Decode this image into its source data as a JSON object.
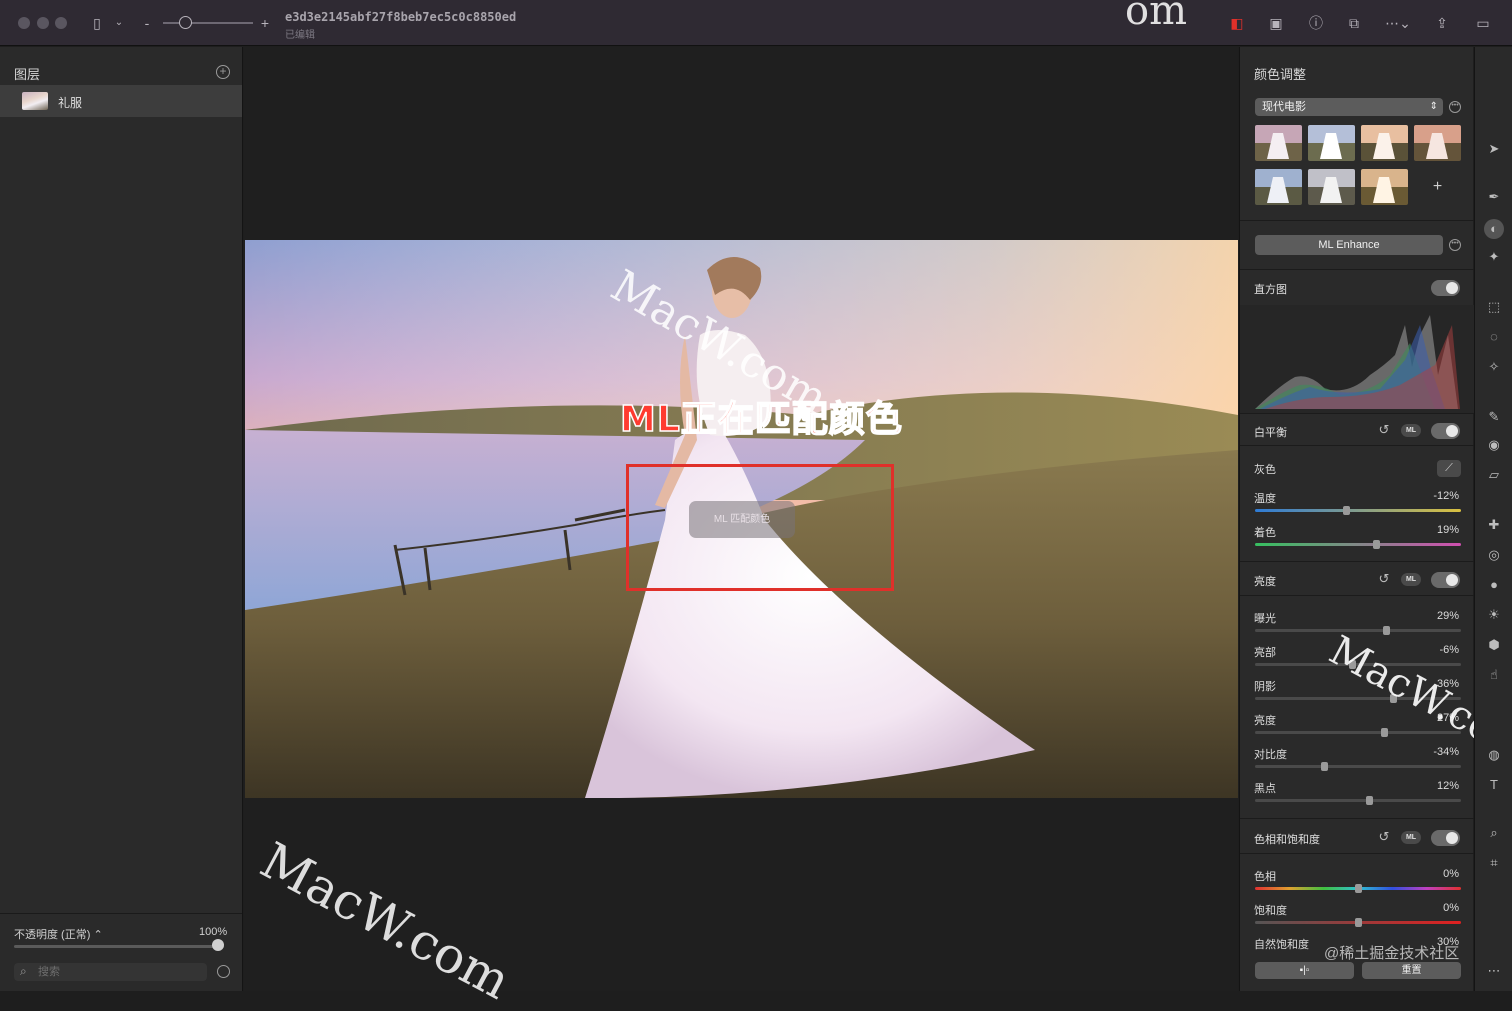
{
  "window": {
    "doc_title": "e3d3e2145abf27f8beb7ec5c0c8850ed",
    "doc_status": "已编辑",
    "minus": "-",
    "plus": "+"
  },
  "layers_panel": {
    "title": "图层",
    "layers": [
      {
        "name": "礼服"
      }
    ],
    "opacity_label": "不透明度 (正常) ⌃",
    "opacity_value": "100%",
    "opacity_fraction": 1.0,
    "search_placeholder": "搜索"
  },
  "canvas": {
    "overlay_text": "ML正在匹配颜色",
    "toast_text": "ML 匹配颜色",
    "watermarks": [
      "MacW.com",
      "MacW.com",
      "MacW.com",
      "MacW.co",
      "om"
    ]
  },
  "color_panel": {
    "title": "颜色调整",
    "preset": "现代电影",
    "preset_thumbnails": 7,
    "ml_enhance": "ML Enhance",
    "histogram": {
      "label": "直方图",
      "enabled": true
    },
    "white_balance": {
      "label": "白平衡",
      "ml": "ML",
      "gray_label": "灰色",
      "rows": [
        {
          "label": "温度",
          "value": "-12%",
          "fraction": -0.12
        },
        {
          "label": "着色",
          "value": "19%",
          "fraction": 0.19
        }
      ]
    },
    "lightness": {
      "label": "亮度",
      "ml": "ML",
      "rows": [
        {
          "label": "曝光",
          "value": "29%",
          "fraction": 0.29
        },
        {
          "label": "亮部",
          "value": "-6%",
          "fraction": -0.06
        },
        {
          "label": "阴影",
          "value": "36%",
          "fraction": 0.36
        },
        {
          "label": "亮度",
          "value": "27%",
          "fraction": 0.27
        },
        {
          "label": "对比度",
          "value": "-34%",
          "fraction": -0.34
        },
        {
          "label": "黑点",
          "value": "12%",
          "fraction": 0.12
        }
      ]
    },
    "hue_saturation": {
      "label": "色相和饱和度",
      "ml": "ML",
      "rows": [
        {
          "label": "色相",
          "value": "0%",
          "fraction": 0.0
        },
        {
          "label": "饱和度",
          "value": "0%",
          "fraction": 0.0
        },
        {
          "label": "自然饱和度",
          "value": "30%",
          "fraction": 0.3
        }
      ]
    },
    "compare_button": "▪|▫",
    "reset_button": "重置",
    "credit": "@稀土掘金技术社区"
  },
  "colors": {
    "accent_red": "#e0302a",
    "panel_bg": "#2a2a2a",
    "titlebar_bg": "#2f2a33"
  }
}
